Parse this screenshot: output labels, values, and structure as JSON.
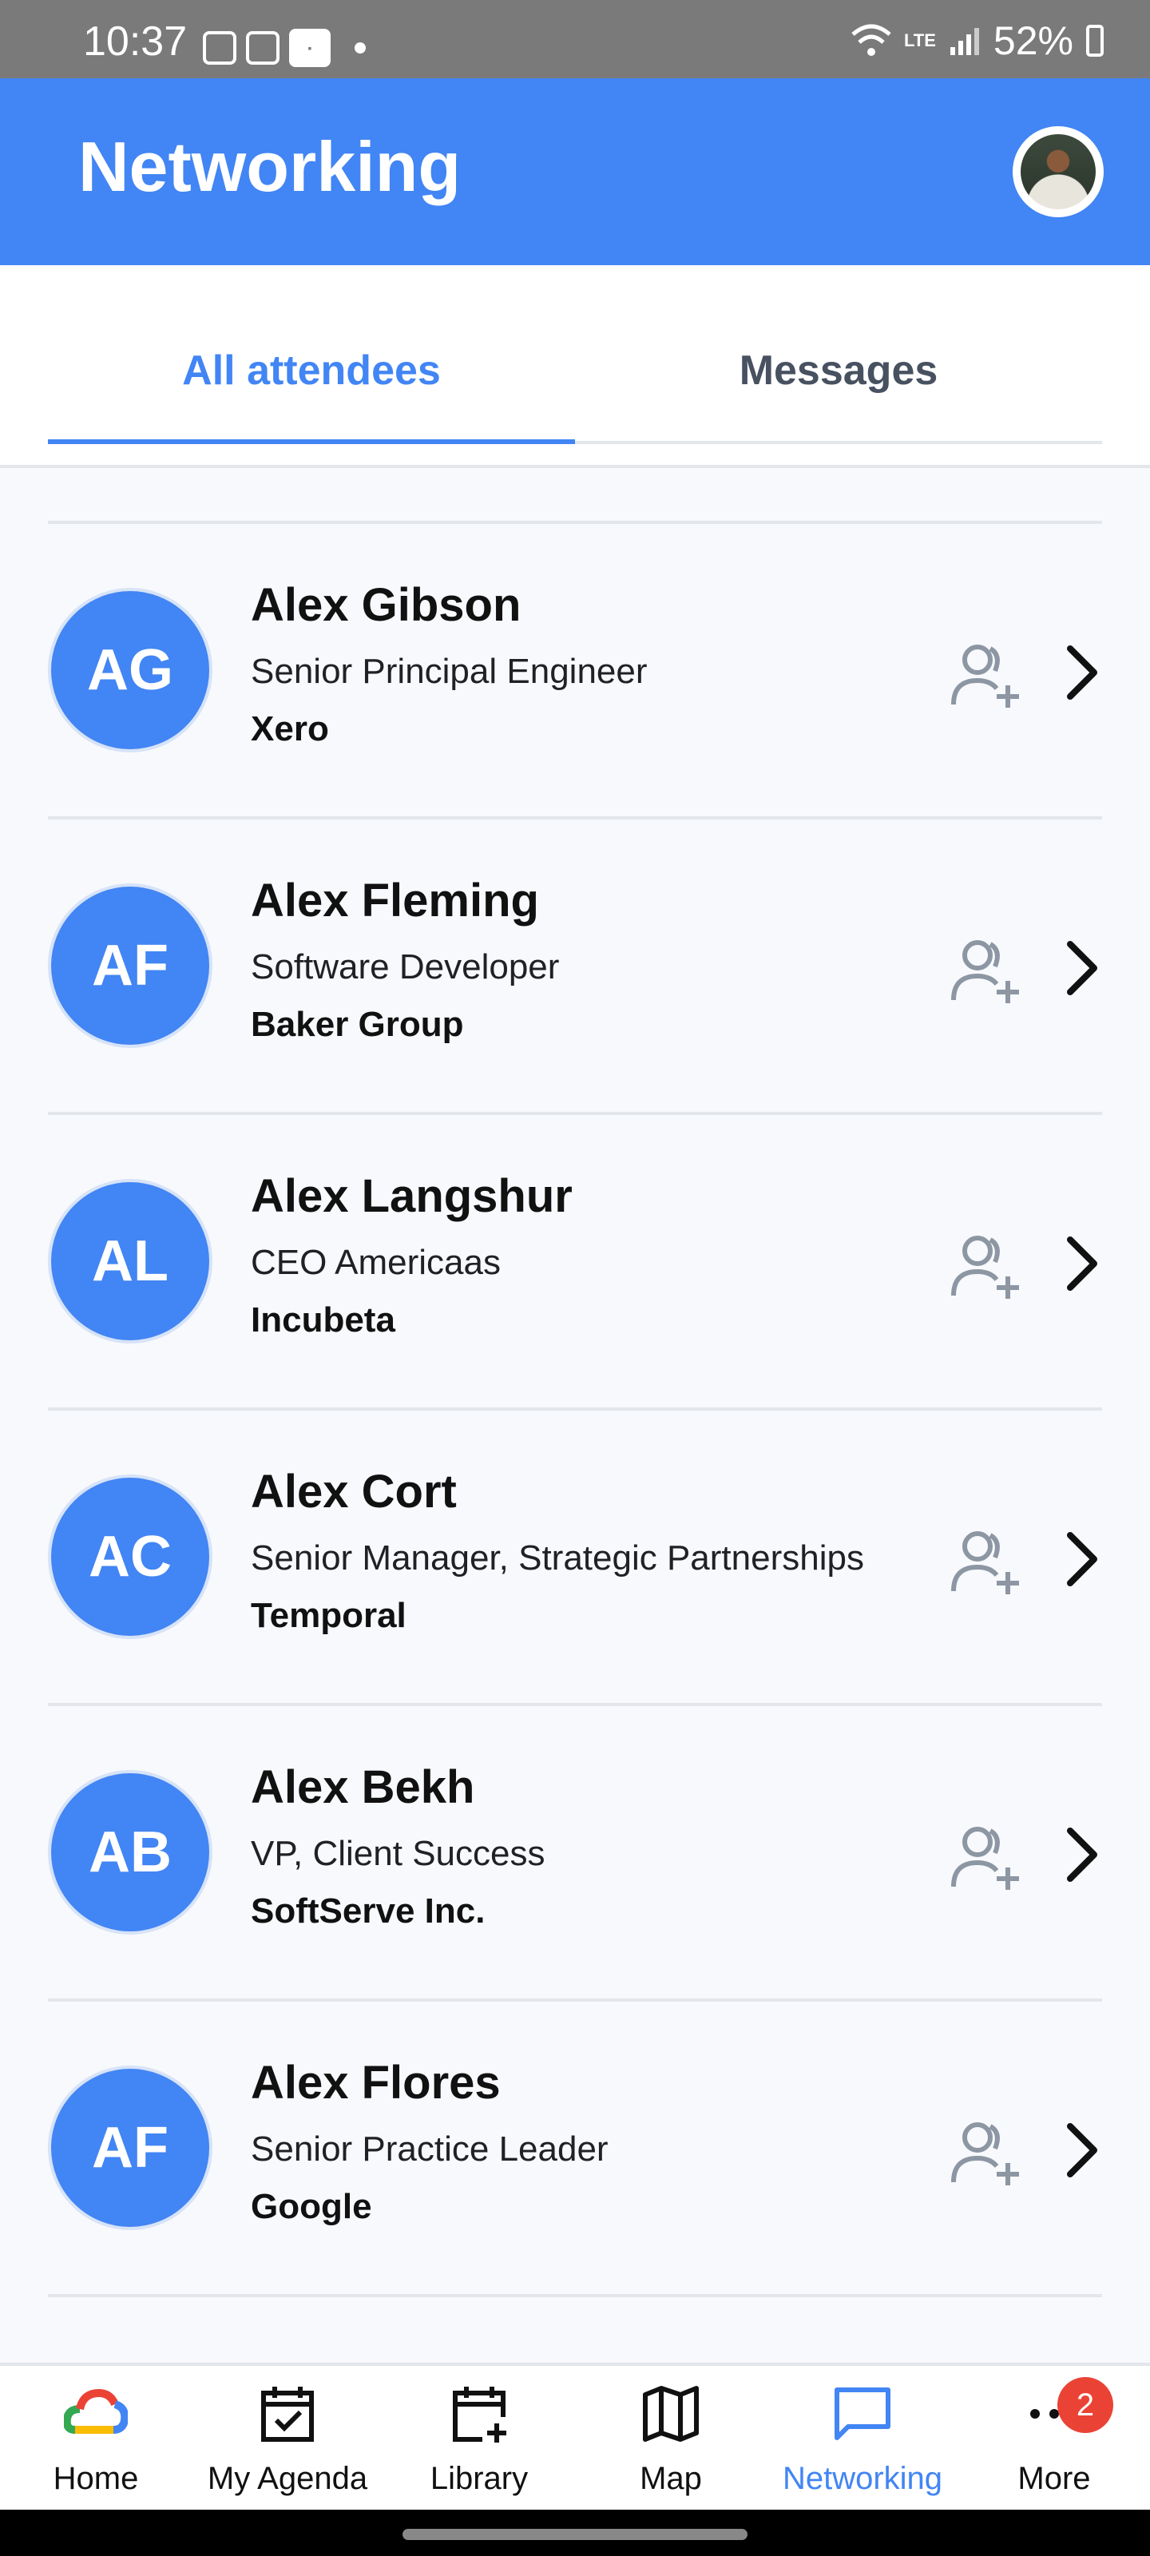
{
  "status": {
    "time": "10:37",
    "battery": "52%",
    "network": "LTE"
  },
  "header": {
    "title": "Networking",
    "avatar_alt": "profile-avatar"
  },
  "tabs": [
    {
      "label": "All attendees"
    },
    {
      "label": "Messages"
    }
  ],
  "attendees": [
    {
      "initials": "AG",
      "name": "Alex Gibson",
      "role": "Senior Principal Engineer",
      "company": "Xero"
    },
    {
      "initials": "AF",
      "name": "Alex Fleming",
      "role": "Software Developer",
      "company": "Baker Group"
    },
    {
      "initials": "AL",
      "name": "Alex Langshur",
      "role": "CEO Americaas",
      "company": "Incubeta"
    },
    {
      "initials": "AC",
      "name": "Alex Cort",
      "role": "Senior Manager, Strategic Partnerships",
      "company": "Temporal"
    },
    {
      "initials": "AB",
      "name": "Alex Bekh",
      "role": "VP, Client Success",
      "company": "SoftServe Inc."
    },
    {
      "initials": "AF",
      "name": "Alex Flores",
      "role": "Senior Practice Leader",
      "company": "Google"
    }
  ],
  "nav": [
    {
      "label": "Home",
      "icon": "google-cloud-icon"
    },
    {
      "label": "My Agenda",
      "icon": "calendar-check-icon"
    },
    {
      "label": "Library",
      "icon": "calendar-plus-icon"
    },
    {
      "label": "Map",
      "icon": "map-icon"
    },
    {
      "label": "Networking",
      "icon": "chat-icon"
    },
    {
      "label": "More",
      "icon": "more-icon",
      "badge": "2"
    }
  ],
  "colors": {
    "primary": "#4285f4",
    "badge": "#ea4335"
  }
}
